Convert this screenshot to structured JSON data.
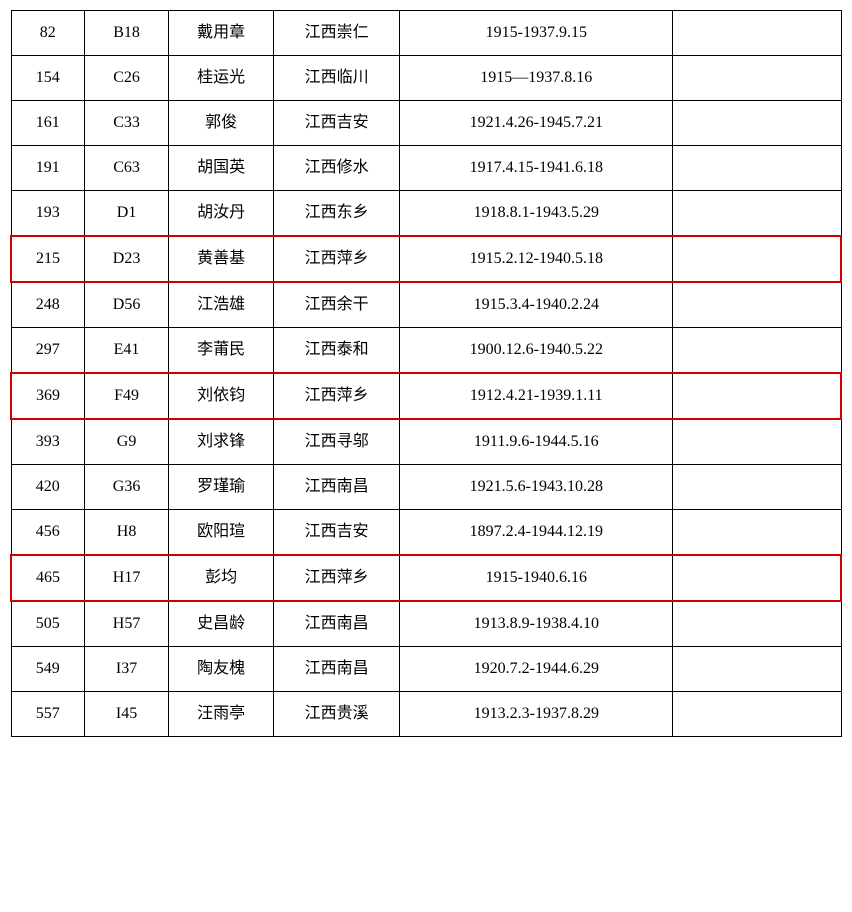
{
  "rows": [
    {
      "id": "82",
      "code": "B18",
      "name": "戴用章",
      "place": "江西崇仁",
      "dates": "1915-1937.9.15",
      "note": "",
      "highlighted": false
    },
    {
      "id": "154",
      "code": "C26",
      "name": "桂运光",
      "place": "江西临川",
      "dates": "1915—1937.8.16",
      "note": "",
      "highlighted": false
    },
    {
      "id": "161",
      "code": "C33",
      "name": "郭俊",
      "place": "江西吉安",
      "dates": "1921.4.26-1945.7.21",
      "note": "",
      "highlighted": false
    },
    {
      "id": "191",
      "code": "C63",
      "name": "胡国英",
      "place": "江西修水",
      "dates": "1917.4.15-1941.6.18",
      "note": "",
      "highlighted": false
    },
    {
      "id": "193",
      "code": "D1",
      "name": "胡汝丹",
      "place": "江西东乡",
      "dates": "1918.8.1-1943.5.29",
      "note": "",
      "highlighted": false
    },
    {
      "id": "215",
      "code": "D23",
      "name": "黄善基",
      "place": "江西萍乡",
      "dates": "1915.2.12-1940.5.18",
      "note": "",
      "highlighted": true
    },
    {
      "id": "248",
      "code": "D56",
      "name": "江浩雄",
      "place": "江西余干",
      "dates": "1915.3.4-1940.2.24",
      "note": "",
      "highlighted": false
    },
    {
      "id": "297",
      "code": "E41",
      "name": "李莆民",
      "place": "江西泰和",
      "dates": "1900.12.6-1940.5.22",
      "note": "",
      "highlighted": false
    },
    {
      "id": "369",
      "code": "F49",
      "name": "刘依钧",
      "place": "江西萍乡",
      "dates": "1912.4.21-1939.1.11",
      "note": "",
      "highlighted": true
    },
    {
      "id": "393",
      "code": "G9",
      "name": "刘求锋",
      "place": "江西寻邬",
      "dates": "1911.9.6-1944.5.16",
      "note": "",
      "highlighted": false
    },
    {
      "id": "420",
      "code": "G36",
      "name": "罗瑾瑜",
      "place": "江西南昌",
      "dates": "1921.5.6-1943.10.28",
      "note": "",
      "highlighted": false
    },
    {
      "id": "456",
      "code": "H8",
      "name": "欧阳瑄",
      "place": "江西吉安",
      "dates": "1897.2.4-1944.12.19",
      "note": "",
      "highlighted": false
    },
    {
      "id": "465",
      "code": "H17",
      "name": "彭均",
      "place": "江西萍乡",
      "dates": "1915-1940.6.16",
      "note": "",
      "highlighted": true
    },
    {
      "id": "505",
      "code": "H57",
      "name": "史昌龄",
      "place": "江西南昌",
      "dates": "1913.8.9-1938.4.10",
      "note": "",
      "highlighted": false
    },
    {
      "id": "549",
      "code": "I37",
      "name": "陶友槐",
      "place": "江西南昌",
      "dates": "1920.7.2-1944.6.29",
      "note": "",
      "highlighted": false
    },
    {
      "id": "557",
      "code": "I45",
      "name": "汪雨亭",
      "place": "江西贵溪",
      "dates": "1913.2.3-1937.8.29",
      "note": "",
      "highlighted": false
    }
  ]
}
